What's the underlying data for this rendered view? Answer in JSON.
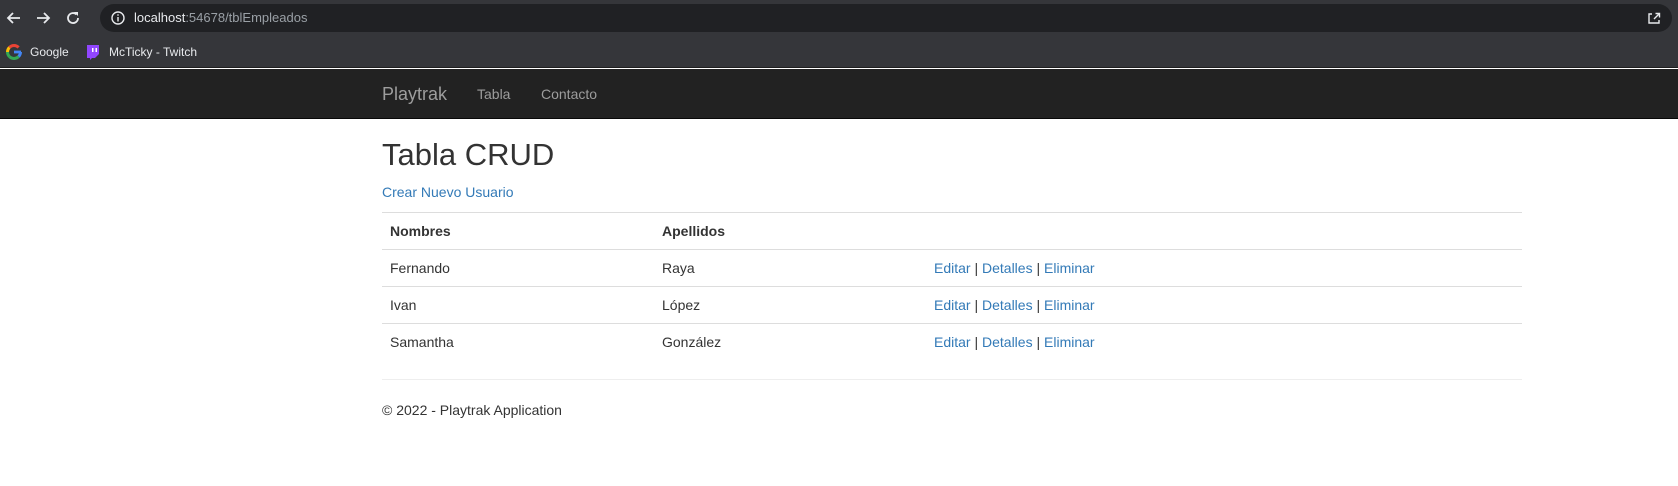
{
  "browser": {
    "url_host": "localhost",
    "url_rest": ":54678/tblEmpleados",
    "icons": {
      "back": "back-arrow-icon",
      "forward": "forward-arrow-icon",
      "reload": "reload-icon",
      "info": "info-icon",
      "share": "share-icon"
    },
    "bookmarks": [
      {
        "label": "Google",
        "icon": "google-icon"
      },
      {
        "label": "McTicky - Twitch",
        "icon": "twitch-icon"
      }
    ]
  },
  "navbar": {
    "brand": "Playtrak",
    "links": [
      "Tabla",
      "Contacto"
    ]
  },
  "main": {
    "title": "Tabla CRUD",
    "create_link": "Crear Nuevo Usuario",
    "table": {
      "headers": [
        "Nombres",
        "Apellidos"
      ],
      "rows": [
        {
          "nombres": "Fernando",
          "apellidos": "Raya"
        },
        {
          "nombres": "Ivan",
          "apellidos": "López"
        },
        {
          "nombres": "Samantha",
          "apellidos": "González"
        }
      ],
      "actions": {
        "edit": "Editar",
        "details": "Detalles",
        "delete": "Eliminar",
        "separator": "|"
      }
    }
  },
  "footer": {
    "text": "© 2022 - Playtrak Application"
  },
  "colors": {
    "link": "#337ab7",
    "navbar_bg": "#222222",
    "navbar_text": "#9d9d9d",
    "chrome_bg": "#35363a",
    "omnibox_bg": "#202124"
  }
}
